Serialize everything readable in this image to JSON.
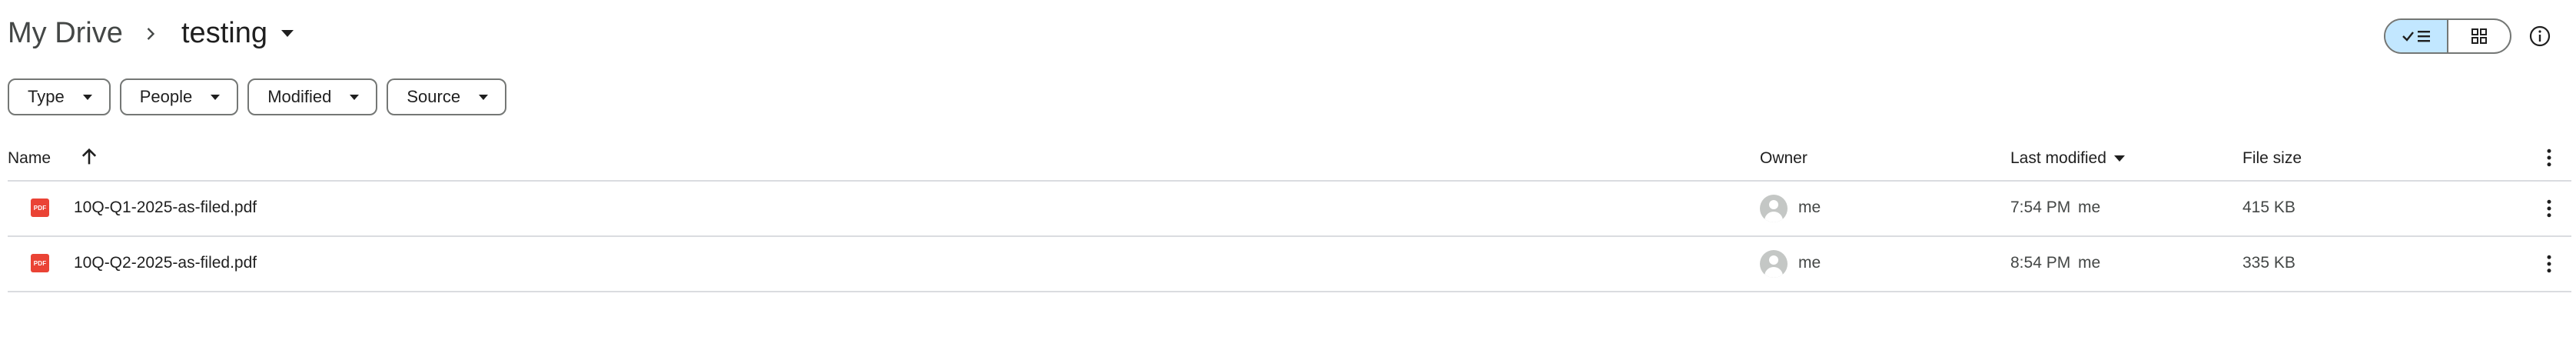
{
  "breadcrumb": {
    "root": "My Drive",
    "current": "testing"
  },
  "view": {
    "mode": "list",
    "list_icon": "check-list-icon",
    "grid_icon": "grid-icon",
    "info_icon": "info-icon"
  },
  "filters": [
    {
      "label": "Type"
    },
    {
      "label": "People"
    },
    {
      "label": "Modified"
    },
    {
      "label": "Source"
    }
  ],
  "columns": {
    "name": "Name",
    "owner": "Owner",
    "last_modified": "Last modified",
    "file_size": "File size"
  },
  "files": [
    {
      "name": "10Q-Q1-2025-as-filed.pdf",
      "type_badge": "PDF",
      "owner": "me",
      "modified_time": "7:54 PM",
      "modified_by": "me",
      "size": "415 KB"
    },
    {
      "name": "10Q-Q2-2025-as-filed.pdf",
      "type_badge": "PDF",
      "owner": "me",
      "modified_time": "8:54 PM",
      "modified_by": "me",
      "size": "335 KB"
    }
  ],
  "colors": {
    "accent": "#c2e7ff",
    "pdf": "#ea4335",
    "divider": "#dadce0"
  }
}
